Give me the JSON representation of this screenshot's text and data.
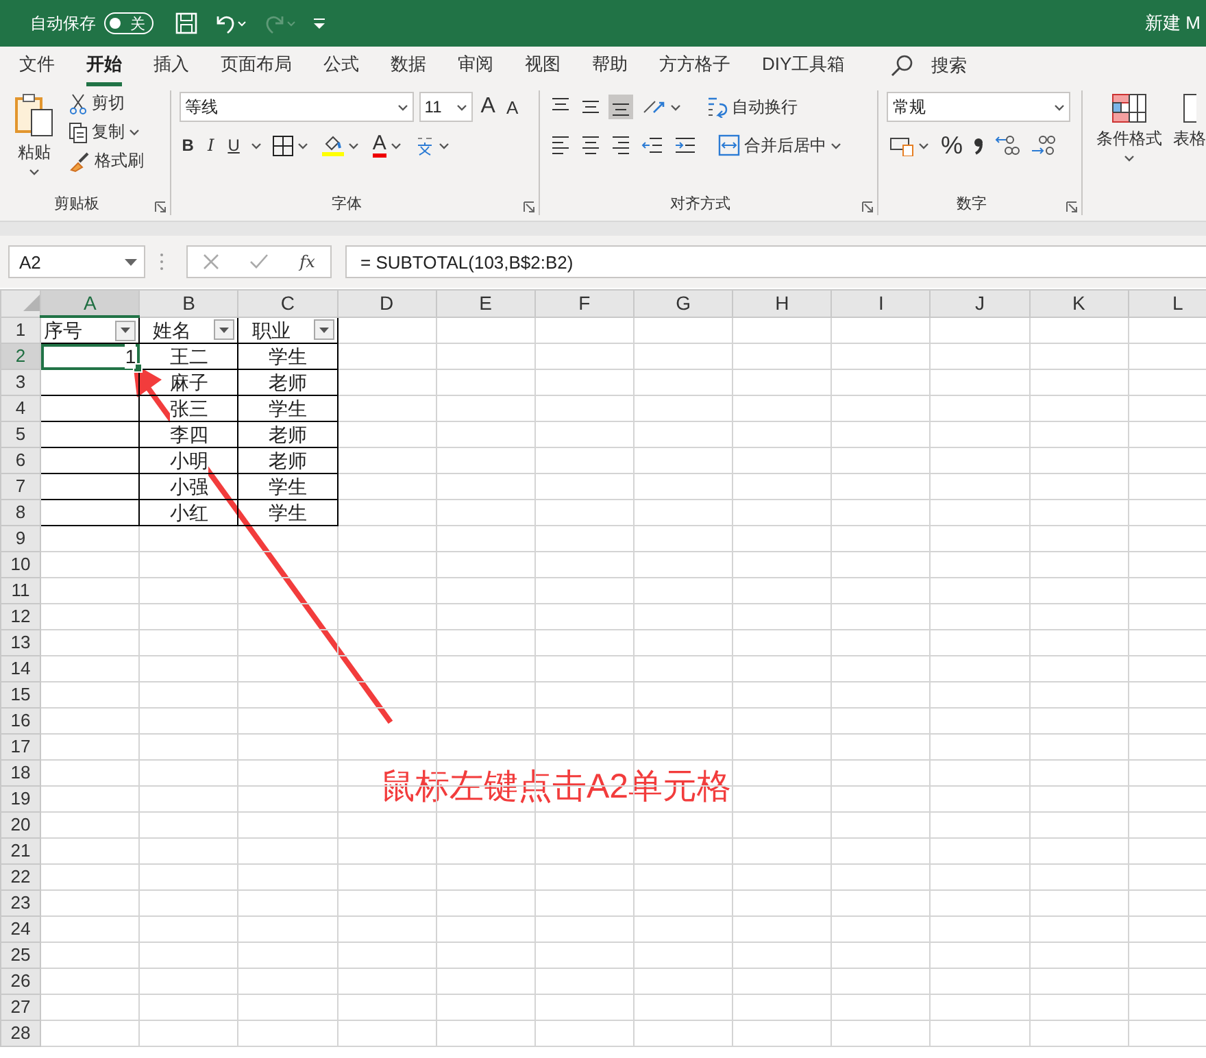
{
  "title_bar": {
    "autosave_label": "自动保存",
    "autosave": {
      "on": false,
      "label": "关"
    },
    "redo": {
      "disabled": true
    },
    "document_title": "新建 M"
  },
  "ribbon_tabs": [
    {
      "label": "文件",
      "selected": false
    },
    {
      "label": "开始",
      "selected": true
    },
    {
      "label": "插入",
      "selected": false
    },
    {
      "label": "页面布局",
      "selected": false
    },
    {
      "label": "公式",
      "selected": false
    },
    {
      "label": "数据",
      "selected": false
    },
    {
      "label": "审阅",
      "selected": false
    },
    {
      "label": "视图",
      "selected": false
    },
    {
      "label": "帮助",
      "selected": false
    },
    {
      "label": "方方格子",
      "selected": false
    },
    {
      "label": "DIY工具箱",
      "selected": false
    }
  ],
  "search": {
    "label": "搜索"
  },
  "ribbon": {
    "clipboard": {
      "title": "剪贴板",
      "paste": "粘贴",
      "cut": "剪切",
      "copy": "复制",
      "format_painter": "格式刷"
    },
    "font": {
      "title": "字体",
      "font_name": "等线",
      "font_size": "11",
      "grow": "A",
      "shrink": "A",
      "bold": "B",
      "italic": "I",
      "underline": "U",
      "font_color": "A"
    },
    "alignment": {
      "title": "对齐方式",
      "vertical_align": [
        {
          "kind": "top",
          "selected": false
        },
        {
          "kind": "middle",
          "selected": false
        },
        {
          "kind": "bottom",
          "selected": true
        }
      ],
      "horizontal_align": [
        {
          "kind": "left",
          "selected": false
        },
        {
          "kind": "center",
          "selected": false
        },
        {
          "kind": "right",
          "selected": false
        }
      ],
      "wrap_text": "自动换行",
      "merge": "合并后居中"
    },
    "number": {
      "title": "数字",
      "format": "常规",
      "percent": "%"
    },
    "styles": {
      "conditional_format": "条件格式",
      "table_format": "表格"
    }
  },
  "formula_bar": {
    "name_box": "A2",
    "fx": "fx",
    "formula": "= SUBTOTAL(103,B$2:B2)"
  },
  "sheet": {
    "columns": [
      {
        "label": "A",
        "selected": true
      },
      {
        "label": "B",
        "selected": false
      },
      {
        "label": "C",
        "selected": false
      },
      {
        "label": "D",
        "selected": false
      },
      {
        "label": "E",
        "selected": false
      },
      {
        "label": "F",
        "selected": false
      },
      {
        "label": "G",
        "selected": false
      },
      {
        "label": "H",
        "selected": false
      },
      {
        "label": "I",
        "selected": false
      },
      {
        "label": "J",
        "selected": false
      },
      {
        "label": "K",
        "selected": false
      },
      {
        "label": "L",
        "selected": false
      }
    ],
    "rows": [
      {
        "label": "1",
        "selected": false,
        "cells": [
          {
            "text": "序号",
            "filter": true,
            "selected": false
          },
          {
            "text": "姓名",
            "filter": true,
            "selected": false
          },
          {
            "text": "职业",
            "filter": true,
            "selected": false
          }
        ]
      },
      {
        "label": "2",
        "selected": true,
        "cells": [
          {
            "text": "1",
            "filter": false,
            "selected": true
          },
          {
            "text": "王二",
            "filter": false,
            "selected": false
          },
          {
            "text": "学生",
            "filter": false,
            "selected": false
          }
        ]
      },
      {
        "label": "3",
        "selected": false,
        "cells": [
          {
            "text": "",
            "filter": false,
            "selected": false
          },
          {
            "text": "麻子",
            "filter": false,
            "selected": false
          },
          {
            "text": "老师",
            "filter": false,
            "selected": false
          }
        ]
      },
      {
        "label": "4",
        "selected": false,
        "cells": [
          {
            "text": "",
            "filter": false,
            "selected": false
          },
          {
            "text": "张三",
            "filter": false,
            "selected": false
          },
          {
            "text": "学生",
            "filter": false,
            "selected": false
          }
        ]
      },
      {
        "label": "5",
        "selected": false,
        "cells": [
          {
            "text": "",
            "filter": false,
            "selected": false
          },
          {
            "text": "李四",
            "filter": false,
            "selected": false
          },
          {
            "text": "老师",
            "filter": false,
            "selected": false
          }
        ]
      },
      {
        "label": "6",
        "selected": false,
        "cells": [
          {
            "text": "",
            "filter": false,
            "selected": false
          },
          {
            "text": "小明",
            "filter": false,
            "selected": false
          },
          {
            "text": "老师",
            "filter": false,
            "selected": false
          }
        ]
      },
      {
        "label": "7",
        "selected": false,
        "cells": [
          {
            "text": "",
            "filter": false,
            "selected": false
          },
          {
            "text": "小强",
            "filter": false,
            "selected": false
          },
          {
            "text": "学生",
            "filter": false,
            "selected": false
          }
        ]
      },
      {
        "label": "8",
        "selected": false,
        "cells": [
          {
            "text": "",
            "filter": false,
            "selected": false
          },
          {
            "text": "小红",
            "filter": false,
            "selected": false
          },
          {
            "text": "学生",
            "filter": false,
            "selected": false
          }
        ]
      },
      {
        "label": "9",
        "selected": false
      },
      {
        "label": "10",
        "selected": false
      },
      {
        "label": "11",
        "selected": false
      },
      {
        "label": "12",
        "selected": false
      },
      {
        "label": "13",
        "selected": false
      },
      {
        "label": "14",
        "selected": false
      },
      {
        "label": "15",
        "selected": false
      },
      {
        "label": "16",
        "selected": false
      },
      {
        "label": "17",
        "selected": false
      },
      {
        "label": "18",
        "selected": false
      },
      {
        "label": "19",
        "selected": false
      },
      {
        "label": "20",
        "selected": false
      },
      {
        "label": "21",
        "selected": false
      },
      {
        "label": "22",
        "selected": false
      },
      {
        "label": "23",
        "selected": false
      },
      {
        "label": "24",
        "selected": false
      },
      {
        "label": "25",
        "selected": false
      },
      {
        "label": "26",
        "selected": false
      },
      {
        "label": "27",
        "selected": false
      },
      {
        "label": "28",
        "selected": false
      }
    ]
  },
  "annotation": {
    "text": "鼠标左键点击A2单元格"
  }
}
